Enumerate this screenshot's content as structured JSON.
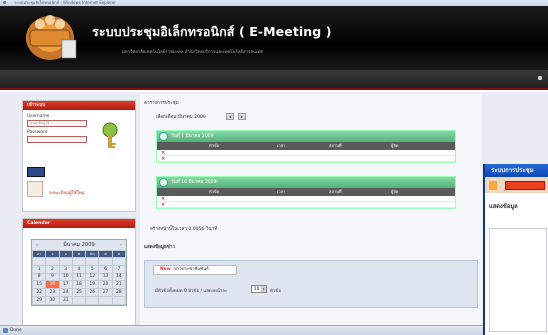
{
  "browser": {
    "title_text": "ระบบประชุมอิเล็กทรอนิกส์ - Windows Internet Explorer",
    "status_text": "Done"
  },
  "header": {
    "app_title": "ระบบประชุมอิเล็กทรอนิกส์ ( E-Meeting )",
    "subtitle": "มหาวิทยาลัยเทคโนโลยีราชมงคล สำนักวิทยบริการและเทคโนโลยีสารสนเทศ"
  },
  "login": {
    "heading": "เข้าระบบ",
    "username_label": "Username",
    "username_placeholder": "กรอกชื่อผู้ใช้",
    "password_label": "Password",
    "register_link": "ลงทะเบียนผู้ใช้ใหม่"
  },
  "calendar": {
    "heading": "Calendar",
    "month_label": "มีนาคม 2009",
    "weekdays": [
      "อา",
      "จ",
      "อ",
      "พ",
      "พฤ",
      "ศ",
      "ส"
    ],
    "weeks": [
      [
        "",
        "",
        "",
        "",
        "",
        "",
        ""
      ],
      [
        "1",
        "2",
        "3",
        "4",
        "5",
        "6",
        "7"
      ],
      [
        "8",
        "9",
        "10",
        "11",
        "12",
        "13",
        "14"
      ],
      [
        "15",
        "16",
        "17",
        "18",
        "19",
        "20",
        "21"
      ],
      [
        "22",
        "23",
        "24",
        "25",
        "26",
        "27",
        "28"
      ],
      [
        "29",
        "30",
        "31",
        "",
        "",
        "",
        ""
      ]
    ],
    "today": "16"
  },
  "main": {
    "section_title": "ตารางการประชุม",
    "month_selector_label": "เลือกเดือน มีนาคม 2009",
    "meetings": [
      {
        "heading": "วันที่ 1 มีนาคม 2009",
        "columns": [
          "หัวข้อ",
          "เวลา",
          "สถานที่",
          "ผู้จัด"
        ]
      },
      {
        "heading": "วันที่ 16 มีนาคม 2009",
        "columns": [
          "หัวข้อ",
          "เวลา",
          "สถานที่",
          "ผู้จัด"
        ]
      }
    ],
    "load_time_text": "สร้างหน้านี้ในเวลา 0.0056 วินาที",
    "news_title": "แสดงข้อมูลข่าว",
    "tab_new": "New",
    "tab_label": "ข่าวประชาสัมพันธ์",
    "filter_text": "มีหัวข้อทั้งหมด 0 หัวข้อ / แสดงหน้าละ",
    "per_page_value": "10",
    "per_page_suffix": "หัวข้อ"
  },
  "window2": {
    "title": "ระบบการประชุม",
    "body_label": "แสดงข้อมูล"
  },
  "colors": {
    "header_bg": "#000000",
    "panel_head": "#c8281a",
    "meeting_head": "#52b078",
    "today": "#ff6a4a"
  }
}
